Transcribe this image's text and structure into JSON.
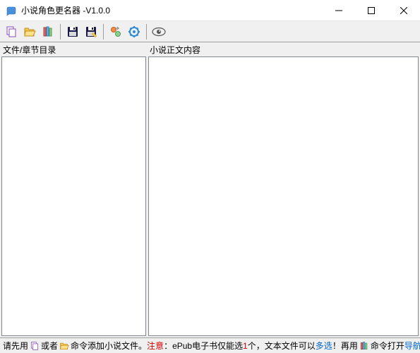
{
  "title": "小说角色更名器  -V1.0.0",
  "toolbar": {
    "copy": "copy-icon",
    "open": "open-folder-icon",
    "books": "books-icon",
    "save": "save-icon",
    "saveas": "save-as-icon",
    "swap": "swap-icon",
    "settings": "settings-icon",
    "preview": "preview-eye-icon"
  },
  "panes": {
    "left_label": "文件/章节目录",
    "right_label": "小说正文内容"
  },
  "status": {
    "s1": "请先用",
    "s2": "或者",
    "s3": "命令添加小说文件。",
    "s4": "注意",
    "s5": "：ePub电子书仅能选",
    "s6": "1",
    "s7": "个，文本文件可以",
    "s8": "多选",
    "s9": "！再用",
    "s10": "命令打开",
    "s11": "导航窗口",
    "s12": "。"
  }
}
